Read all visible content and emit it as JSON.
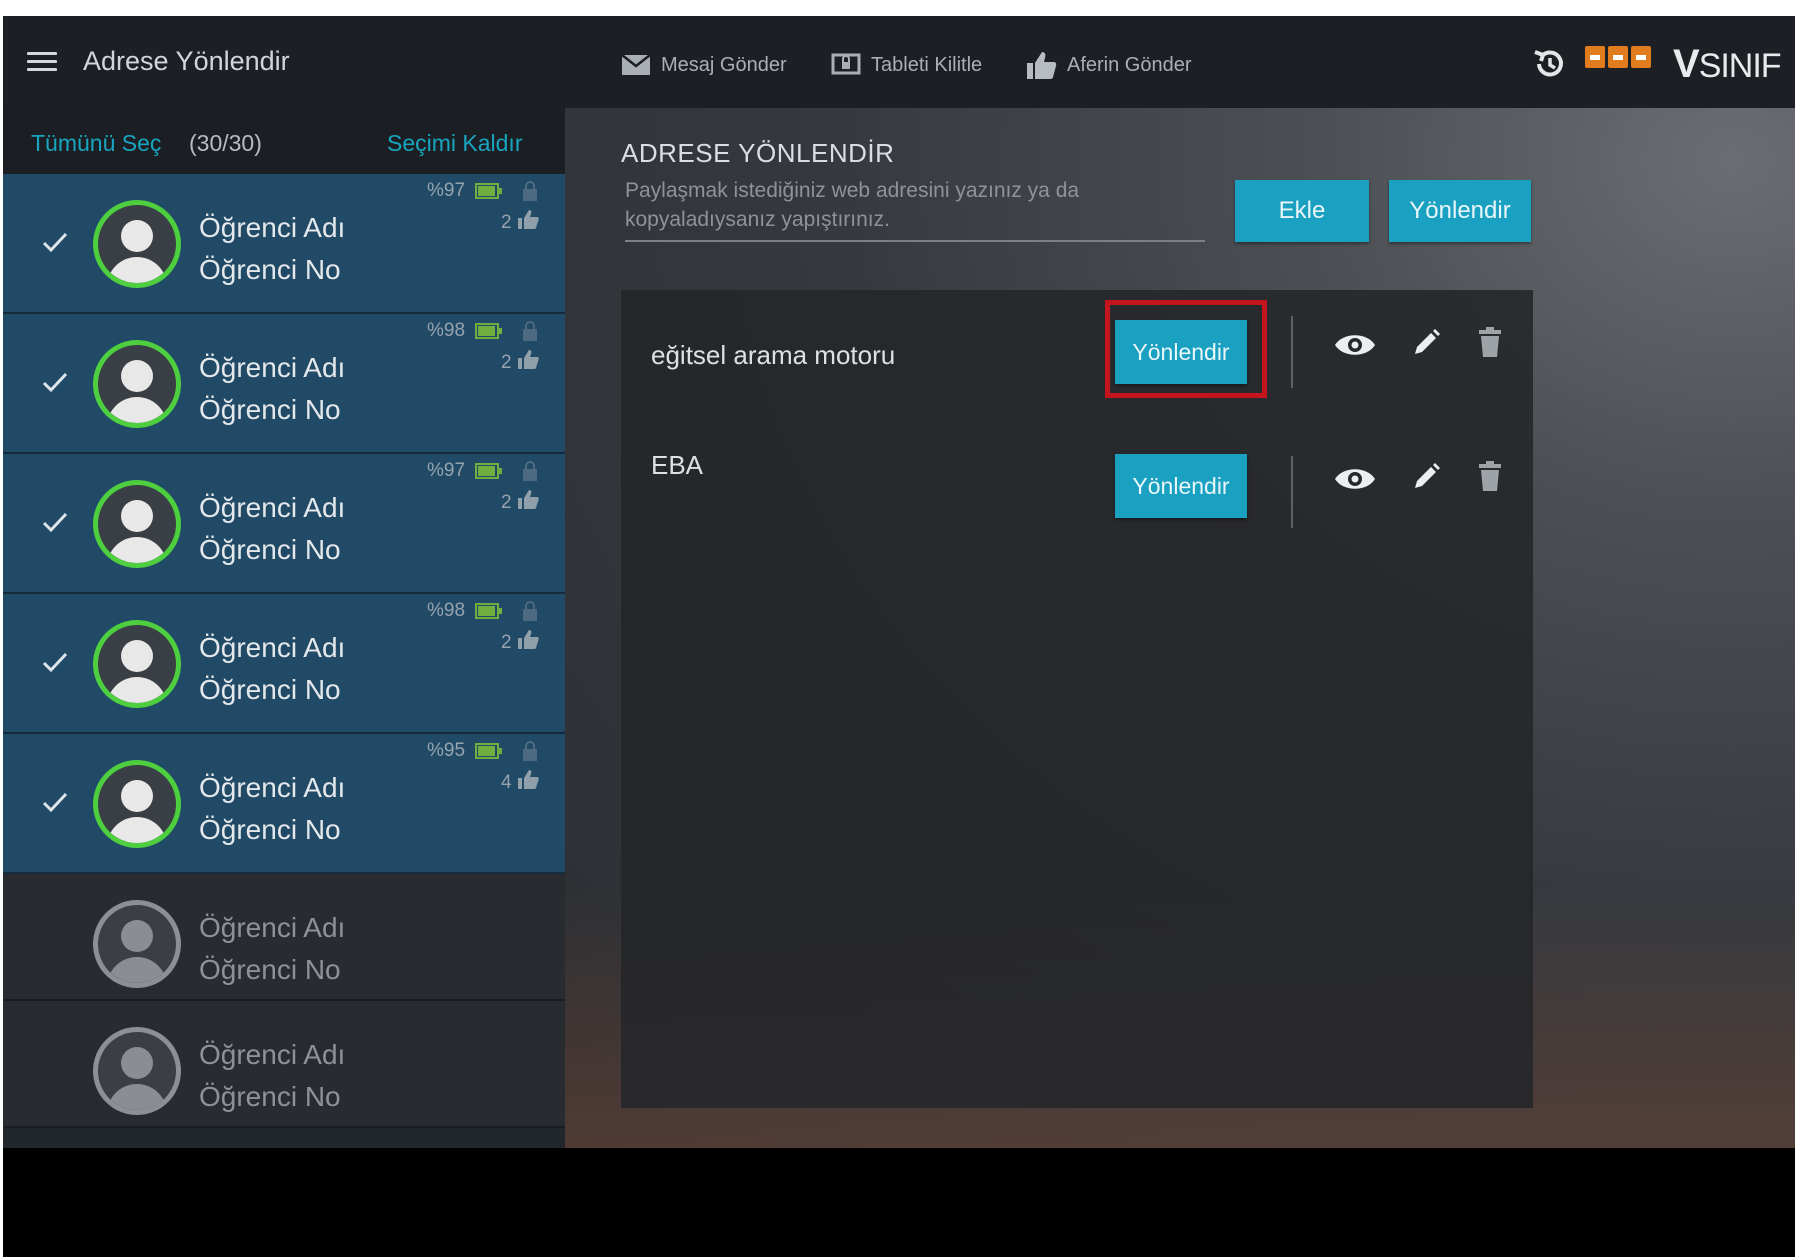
{
  "header": {
    "title": "Adrese Yönlendir",
    "toolbar": {
      "send_message": "Mesaj Gönder",
      "lock_tablet": "Tableti Kilitle",
      "send_bravo": "Aferin Gönder"
    },
    "brand_text": "SINIF",
    "brand_letter": "V"
  },
  "sidebar": {
    "select_all": "Tümünü Seç",
    "count": "(30/30)",
    "deselect": "Seçimi Kaldır",
    "students": [
      {
        "name": "Öğrenci Adı",
        "number": "Öğrenci No",
        "battery": "%97",
        "likes": "2",
        "selected": true
      },
      {
        "name": "Öğrenci Adı",
        "number": "Öğrenci No",
        "battery": "%98",
        "likes": "2",
        "selected": true
      },
      {
        "name": "Öğrenci Adı",
        "number": "Öğrenci No",
        "battery": "%97",
        "likes": "2",
        "selected": true
      },
      {
        "name": "Öğrenci Adı",
        "number": "Öğrenci No",
        "battery": "%98",
        "likes": "2",
        "selected": true
      },
      {
        "name": "Öğrenci Adı",
        "number": "Öğrenci No",
        "battery": "%95",
        "likes": "4",
        "selected": true
      },
      {
        "name": "Öğrenci Adı",
        "number": "Öğrenci No",
        "selected": false
      },
      {
        "name": "Öğrenci Adı",
        "number": "Öğrenci No",
        "selected": false
      }
    ]
  },
  "main": {
    "section_title": "ADRESE YÖNLENDİR",
    "url_placeholder": "Paylaşmak istediğiniz web adresini yazınız ya da kopyaladıysanız yapıştırınız.",
    "add_button": "Ekle",
    "redirect_button": "Yönlendir",
    "links": [
      {
        "label": "eğitsel arama motoru",
        "button": "Yönlendir"
      },
      {
        "label": "EBA",
        "button": "Yönlendir"
      }
    ]
  },
  "colors": {
    "accent": "#1aa0c0",
    "selected_row": "#214a67",
    "avatar_ring": "#4ecf3f",
    "highlight": "#c4141d",
    "brand_orange": "#e07b1e"
  }
}
